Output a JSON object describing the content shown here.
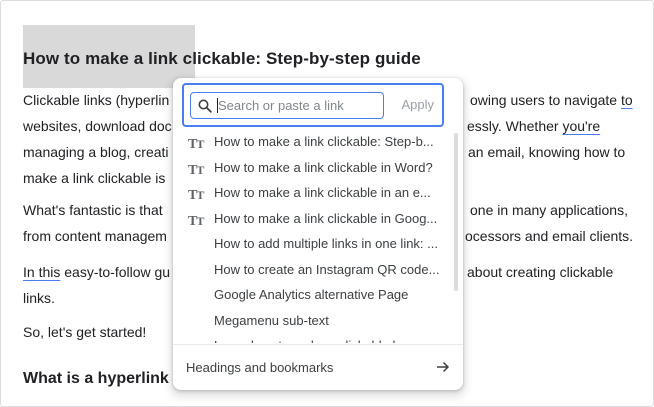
{
  "document": {
    "title": "How to make a link clickable: Step-by-step guide",
    "para1": {
      "line1": "Clickable links (hyperlin",
      "line1_right_prefix": "owing users to navigate ",
      "line1_right_link": "to",
      "line2": "websites, download doc",
      "line2_right_prefix": "essly. Whether ",
      "line2_right_link": "you're",
      "line3": "managing a blog, creati",
      "line3_right": "an email, knowing how to",
      "line4": "make a link clickable is"
    },
    "para2": {
      "line1": "What's fantastic is that",
      "line1_right": "one in many applications,",
      "line2": "from content managem",
      "line2_right": "ocessors and email clients."
    },
    "para3": {
      "line1_link": "In this",
      "line1": " easy-to-follow gu",
      "line1_right": "about creating clickable",
      "line2": "links."
    },
    "para4": "So, let's get started!",
    "subheading": "What is a hyperlink"
  },
  "link_popup": {
    "search": {
      "placeholder": "Search or paste a link",
      "value": ""
    },
    "apply_label": "Apply",
    "suggestions": [
      {
        "type": "heading",
        "icon": "heading-icon",
        "label": "How to make a link clickable: Step-b..."
      },
      {
        "type": "heading",
        "icon": "heading-icon",
        "label": "How to make a link clickable in Word?"
      },
      {
        "type": "heading",
        "icon": "heading-icon",
        "label": "How to make a link clickable in an e..."
      },
      {
        "type": "heading",
        "icon": "heading-icon",
        "label": "How to make a link clickable in Goog..."
      },
      {
        "type": "doc",
        "icon": "google-doc-icon",
        "label": "How to add multiple links in one link: ..."
      },
      {
        "type": "doc",
        "icon": "google-doc-icon",
        "label": "How to create an Instagram QR code..."
      },
      {
        "type": "doc",
        "icon": "google-doc-icon",
        "label": "Google Analytics alternative Page"
      },
      {
        "type": "doc",
        "icon": "google-doc-icon",
        "label": "Megamenu sub-text"
      },
      {
        "type": "doc",
        "icon": "google-doc-icon",
        "label": "Learn how to make a clickable hyper..."
      }
    ],
    "footer_label": "Headings and bookmarks",
    "footer_icon": "arrow-right-icon"
  },
  "colors": {
    "accent": "#4a7df0",
    "doc_blue": "#4285f4",
    "highlight": "#d9d9d9"
  }
}
